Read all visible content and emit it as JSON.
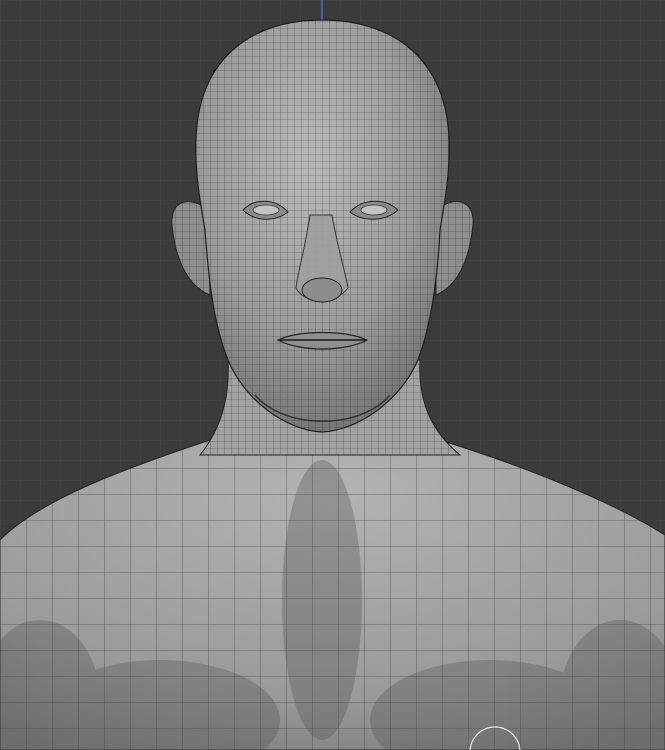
{
  "viewport": {
    "background_color": "#3b3b3b",
    "grid_minor_color": "#474747",
    "grid_major_color": "#545454",
    "mesh_fill_color": "#9a9a9a",
    "mesh_wire_color": "#2a2a2a",
    "axis_color": "#3f6fd1",
    "cursor_color": "#e6e6e6"
  },
  "icons": {
    "brush_cursor": "brush-circle-icon",
    "z_axis": "z-axis-line-icon"
  }
}
